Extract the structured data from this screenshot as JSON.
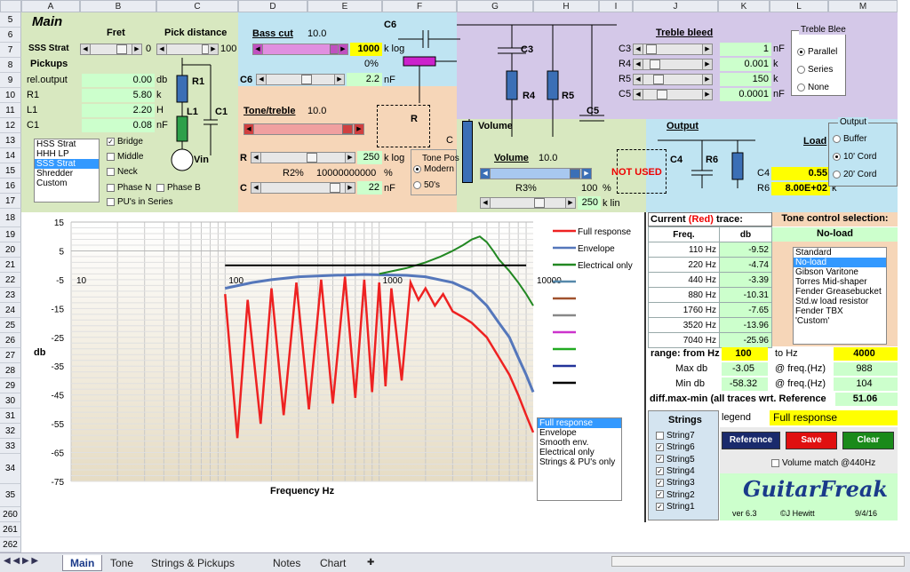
{
  "columns": [
    "A",
    "B",
    "C",
    "D",
    "E",
    "F",
    "G",
    "H",
    "I",
    "J",
    "K",
    "L",
    "M"
  ],
  "rows": [
    "5",
    "6",
    "7",
    "8",
    "9",
    "10",
    "11",
    "12",
    "13",
    "14",
    "15",
    "16",
    "17",
    "18",
    "19",
    "20",
    "21",
    "22",
    "23",
    "24",
    "25",
    "26",
    "27",
    "28",
    "29",
    "30",
    "31",
    "32",
    "33",
    "34",
    "35",
    "260",
    "261",
    "262"
  ],
  "header": {
    "main": "Main",
    "fret": "Fret",
    "pick_distance": "Pick distance",
    "guitar": "SSS Strat",
    "fret_val": "0",
    "pick_val": "100"
  },
  "pickups": {
    "title": "Pickups",
    "rows": [
      {
        "label": "rel.output",
        "value": "0.00",
        "unit": "db"
      },
      {
        "label": "R1",
        "value": "5.80",
        "unit": "k"
      },
      {
        "label": "L1",
        "value": "2.20",
        "unit": "H"
      },
      {
        "label": "C1",
        "value": "0.08",
        "unit": "nF"
      }
    ],
    "list": [
      "HSS Strat",
      "HHH LP",
      "SSS Strat",
      "Shredder",
      "Custom"
    ],
    "selected": "SSS Strat",
    "checks": [
      {
        "label": "Bridge",
        "checked": true
      },
      {
        "label": "Middle",
        "checked": false
      },
      {
        "label": "Neck",
        "checked": false
      },
      {
        "label": "Phase N",
        "checked": false
      },
      {
        "label": "Phase B",
        "checked": false
      },
      {
        "label": "PU's in Series",
        "checked": false
      }
    ],
    "sch": {
      "r1": "R1",
      "l1": "L1",
      "c1": "C1",
      "vin": "Vin"
    }
  },
  "bass_cut": {
    "title": "Bass cut",
    "value": "10.0",
    "k": "1000",
    "k_unit": "k log",
    "pct": "0%",
    "c6_label": "C6",
    "c6": "2.2",
    "c6_unit": "nF",
    "cap": "C6"
  },
  "tone": {
    "title": "Tone/treble",
    "value": "10.0",
    "r_label": "R",
    "r": "250",
    "r_unit": "k log",
    "r2_label": "R2%",
    "r2": "10000000000",
    "r2_unit": "%",
    "c_label": "C",
    "c": "22",
    "c_unit": "nF",
    "pos_title": "Tone Pos",
    "pos_opts": [
      {
        "label": "Modern",
        "on": true
      },
      {
        "label": "50's",
        "on": false
      }
    ],
    "sch_r": "R",
    "sch_c": "C"
  },
  "circuit": {
    "c3": "C3",
    "r4": "R4",
    "r5": "R5",
    "c5": "C5",
    "volume": "Volume"
  },
  "treble": {
    "title": "Treble bleed",
    "rows": [
      {
        "label": "C3",
        "value": "1",
        "unit": "nF"
      },
      {
        "label": "R4",
        "value": "0.001",
        "unit": "k"
      },
      {
        "label": "R5",
        "value": "150",
        "unit": "k"
      },
      {
        "label": "C5",
        "value": "0.0001",
        "unit": "nF"
      }
    ],
    "group": "Treble Blee",
    "opts": [
      {
        "label": "Parallel",
        "on": true
      },
      {
        "label": "Series",
        "on": false
      },
      {
        "label": "None",
        "on": false
      }
    ]
  },
  "volume": {
    "title": "Volume",
    "value": "10.0",
    "r3_label": "R3%",
    "r3": "100",
    "r3_unit": "%",
    "k": "250",
    "k_unit": "k lin",
    "not_used": "NOT USED"
  },
  "output": {
    "title": "Output",
    "load": "Load",
    "c4_sch": "C4",
    "r6_sch": "R6",
    "c4_label": "C4",
    "c4": "0.55",
    "r6_label": "R6",
    "r6": "8.00E+02",
    "r6_unit": "k",
    "group": "Output",
    "opts": [
      {
        "label": "Buffer",
        "on": false
      },
      {
        "label": "10' Cord",
        "on": true
      },
      {
        "label": "20' Cord",
        "on": false
      }
    ]
  },
  "chart_data": {
    "type": "line",
    "xlabel": "Frequency Hz",
    "ylabel": "db",
    "xscale": "log",
    "xlim": [
      10,
      10000
    ],
    "ylim": [
      -75,
      15
    ],
    "yticks": [
      15,
      5,
      -5,
      -15,
      -25,
      -35,
      -45,
      -55,
      -65,
      -75
    ],
    "xticks": [
      {
        "v": 10,
        "t": "10"
      },
      {
        "v": 100,
        "t": "100"
      },
      {
        "v": 1000,
        "t": "1000"
      },
      {
        "v": 10000,
        "t": "10000"
      }
    ],
    "series": [
      {
        "name": "Full response",
        "color": "#ee2222",
        "x": [
          100,
          120,
          140,
          170,
          200,
          240,
          290,
          350,
          420,
          500,
          600,
          700,
          800,
          900,
          1000,
          1100,
          1200,
          1400,
          1600,
          1800,
          2000,
          2300,
          2600,
          3000,
          3500,
          4000,
          5000,
          6000,
          7000,
          8000,
          9000,
          10000
        ],
        "y": [
          -10,
          -60,
          -12,
          -55,
          -8,
          -52,
          -6,
          -50,
          -5,
          -48,
          -4,
          -46,
          -5,
          -44,
          -6,
          -42,
          -8,
          -40,
          -6,
          -12,
          -8,
          -14,
          -10,
          -16,
          -18,
          -20,
          -25,
          -32,
          -38,
          -45,
          -52,
          -58
        ]
      },
      {
        "name": "Envelope",
        "color": "#5577bb",
        "x": [
          100,
          150,
          200,
          300,
          500,
          800,
          1000,
          1500,
          2000,
          3000,
          4000,
          5000,
          6000,
          7000,
          8000,
          9000,
          10000
        ],
        "y": [
          -8,
          -6,
          -5,
          -4,
          -3.5,
          -3.2,
          -3.3,
          -3.5,
          -4,
          -6,
          -9,
          -14,
          -20,
          -25,
          -32,
          -38,
          -44
        ]
      },
      {
        "name": "Electrical only",
        "color": "#228822",
        "x": [
          1000,
          1500,
          2000,
          2500,
          3000,
          3500,
          4000,
          4500,
          5000,
          5500,
          6000,
          7000,
          8000,
          9000,
          10000
        ],
        "y": [
          -3,
          -1,
          1,
          3,
          5,
          7,
          9,
          10,
          8,
          5,
          2,
          -2,
          -6,
          -10,
          -14
        ]
      },
      {
        "name": "Reference",
        "color": "#000000",
        "x": [
          10,
          10000
        ],
        "y": [
          0,
          0
        ]
      }
    ],
    "legend_extra_colors": [
      "#5588aa",
      "#a0522d",
      "#888888",
      "#cc33cc",
      "#22aa22",
      "#223399",
      "#000000"
    ]
  },
  "chart_list": {
    "items": [
      "Full response",
      "Envelope",
      "Smooth env.",
      "Electrical only",
      "Strings & PU's only"
    ],
    "selected": "Full response"
  },
  "trace": {
    "title_a": "Current",
    "title_red": "(Red)",
    "title_b": "trace:",
    "col_freq": "Freq.",
    "col_db": "db",
    "rows": [
      {
        "f": "110 Hz",
        "db": "-9.52"
      },
      {
        "f": "220 Hz",
        "db": "-4.74"
      },
      {
        "f": "440 Hz",
        "db": "-3.39"
      },
      {
        "f": "880 Hz",
        "db": "-10.31"
      },
      {
        "f": "1760 Hz",
        "db": "-7.65"
      },
      {
        "f": "3520 Hz",
        "db": "-13.96"
      },
      {
        "f": "7040 Hz",
        "db": "-25.96"
      }
    ],
    "range_label": "range: from Hz",
    "from": "100",
    "to_label": "to Hz",
    "to": "4000",
    "max_label": "Max db",
    "max": "-3.05",
    "maxf_label": "@ freq.(Hz)",
    "maxf": "988",
    "min_label": "Min db",
    "min": "-58.32",
    "minf_label": "@ freq.(Hz)",
    "minf": "104",
    "diff_label": "diff.max-min (all traces wrt. Reference",
    "diff": "51.06"
  },
  "tone_ctrl": {
    "title": "Tone control selection:",
    "current": "No-load",
    "list": [
      "Standard",
      "No-load",
      "Gibson Varitone",
      "Torres Mid-shaper",
      "Fender Greasebucket",
      "Std.w load resistor",
      "Fender TBX",
      "'Custom'"
    ],
    "selected": "No-load"
  },
  "strings": {
    "title": "Strings",
    "items": [
      {
        "label": "String7",
        "checked": false
      },
      {
        "label": "String6",
        "checked": true
      },
      {
        "label": "String5",
        "checked": true
      },
      {
        "label": "String4",
        "checked": true
      },
      {
        "label": "String3",
        "checked": true
      },
      {
        "label": "String2",
        "checked": true
      },
      {
        "label": "String1",
        "checked": true
      }
    ]
  },
  "legend_panel": {
    "label": "legend",
    "value": "Full response",
    "reference": "Reference",
    "save": "Save",
    "clear": "Clear",
    "volume_match": "Volume match @440Hz"
  },
  "brand": {
    "name": "GuitarFreak",
    "version": "ver 6.3",
    "author": "©J Hewitt",
    "date": "9/4/16"
  },
  "tabs": [
    "Main",
    "Tone",
    "Strings & Pickups",
    "Notes",
    "Chart"
  ],
  "active_tab": "Main"
}
